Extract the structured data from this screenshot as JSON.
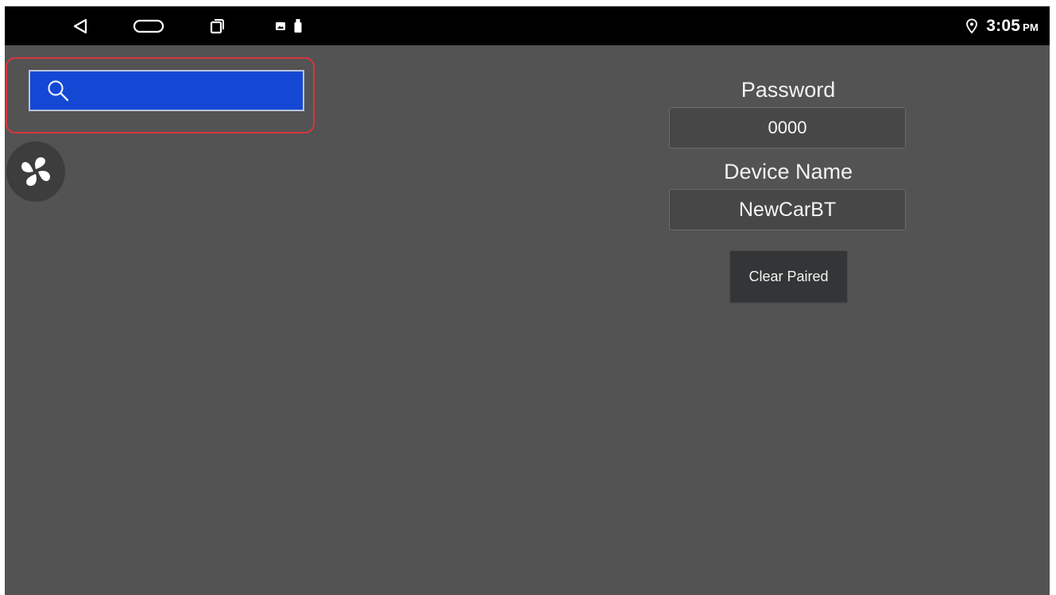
{
  "status_bar": {
    "time": "3:05",
    "ampm": "PM",
    "icons": [
      "back-icon",
      "home-icon",
      "recents-icon",
      "notification-image-icon",
      "usb-icon",
      "location-icon"
    ]
  },
  "search": {
    "value": "",
    "placeholder": "",
    "icon": "search-icon",
    "highlight_color": "#d9343c",
    "background_color": "#1448d4"
  },
  "fan_button": {
    "icon": "fan-icon"
  },
  "bluetooth": {
    "password_label": "Password",
    "password_value": "0000",
    "device_name_label": "Device Name",
    "device_name_value": "NewCarBT",
    "clear_button_label": "Clear Paired"
  },
  "colors": {
    "background": "#535353",
    "status_bar": "#000000",
    "field_bg": "#474747",
    "button_bg": "#333536"
  }
}
